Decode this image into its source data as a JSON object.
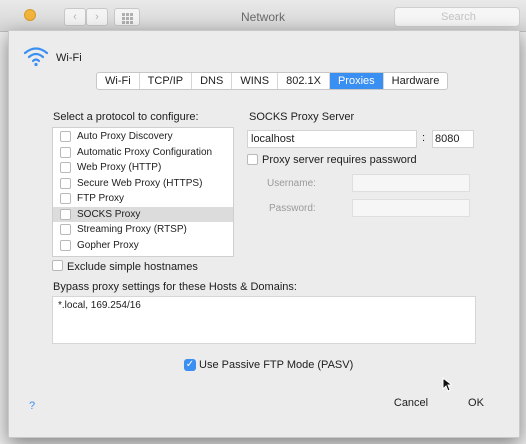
{
  "window": {
    "title": "Network",
    "search_placeholder": "Search",
    "back_glyph": "‹",
    "forward_glyph": "›"
  },
  "interface": {
    "name": "Wi-Fi",
    "icon": "wifi-icon"
  },
  "tabs": [
    {
      "label": "Wi-Fi",
      "active": false
    },
    {
      "label": "TCP/IP",
      "active": false
    },
    {
      "label": "DNS",
      "active": false
    },
    {
      "label": "WINS",
      "active": false
    },
    {
      "label": "802.1X",
      "active": false
    },
    {
      "label": "Proxies",
      "active": true
    },
    {
      "label": "Hardware",
      "active": false
    }
  ],
  "protocols": {
    "title": "Select a protocol to configure:",
    "items": [
      {
        "label": "Auto Proxy Discovery",
        "checked": false,
        "selected": false
      },
      {
        "label": "Automatic Proxy Configuration",
        "checked": false,
        "selected": false
      },
      {
        "label": "Web Proxy (HTTP)",
        "checked": false,
        "selected": false
      },
      {
        "label": "Secure Web Proxy (HTTPS)",
        "checked": false,
        "selected": false
      },
      {
        "label": "FTP Proxy",
        "checked": false,
        "selected": false
      },
      {
        "label": "SOCKS Proxy",
        "checked": false,
        "selected": true
      },
      {
        "label": "Streaming Proxy (RTSP)",
        "checked": false,
        "selected": false
      },
      {
        "label": "Gopher Proxy",
        "checked": false,
        "selected": false
      }
    ]
  },
  "exclude_simple": {
    "label": "Exclude simple hostnames",
    "checked": false
  },
  "socks": {
    "title": "SOCKS Proxy Server",
    "host": "localhost",
    "colon": ":",
    "port": "8080",
    "requires_password_label": "Proxy server requires password",
    "requires_password": false,
    "username_label": "Username:",
    "password_label": "Password:"
  },
  "bypass": {
    "label": "Bypass proxy settings for these Hosts & Domains:",
    "value": "*.local, 169.254/16"
  },
  "pasv": {
    "label": "Use Passive FTP Mode (PASV)",
    "checked": true,
    "check_glyph": "✓"
  },
  "buttons": {
    "help": "?",
    "cancel": "Cancel",
    "ok": "OK"
  },
  "colors": {
    "accent": "#3a8ff2",
    "sheet_bg": "#ececec"
  }
}
